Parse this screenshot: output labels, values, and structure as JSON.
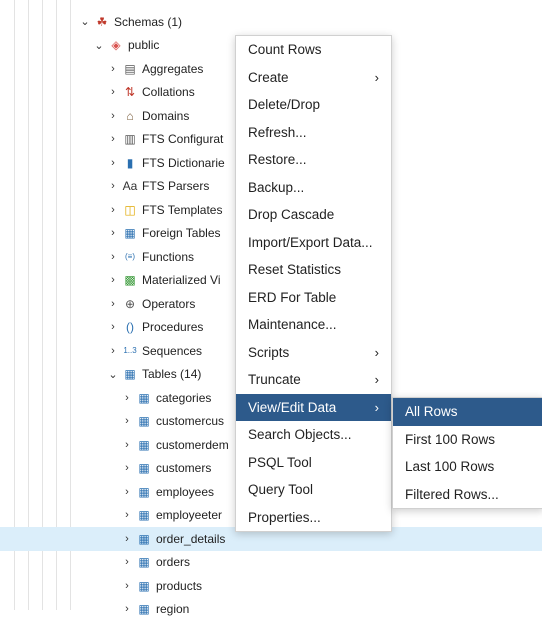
{
  "tree": {
    "items": [
      {
        "label": "Schemas (1)",
        "icon": "schemas-icon",
        "glyph": "☘",
        "color": "#c0392b",
        "expanded": true
      },
      {
        "label": "public",
        "icon": "schema-icon",
        "glyph": "◈",
        "color": "#d9534f",
        "expanded": true
      },
      {
        "label": "Aggregates",
        "icon": "aggregates-icon",
        "glyph": "▤",
        "color": "#555"
      },
      {
        "label": "Collations",
        "icon": "collations-icon",
        "glyph": "⇅",
        "color": "#c0392b"
      },
      {
        "label": "Domains",
        "icon": "domains-icon",
        "glyph": "⌂",
        "color": "#7a5c3a"
      },
      {
        "label": "FTS Configurat",
        "icon": "fts-configuration-icon",
        "glyph": "▥",
        "color": "#555"
      },
      {
        "label": "FTS Dictionarie",
        "icon": "fts-dictionaries-icon",
        "glyph": "▮",
        "color": "#2a6fb0"
      },
      {
        "label": "FTS Parsers",
        "icon": "fts-parsers-icon",
        "glyph": "Aa",
        "color": "#333"
      },
      {
        "label": "FTS Templates",
        "icon": "fts-templates-icon",
        "glyph": "◫",
        "color": "#e0a800"
      },
      {
        "label": "Foreign Tables",
        "icon": "foreign-tables-icon",
        "glyph": "▦",
        "color": "#2a6fb0"
      },
      {
        "label": "Functions",
        "icon": "functions-icon",
        "glyph": "(≡)",
        "color": "#2a6fb0"
      },
      {
        "label": "Materialized Vi",
        "icon": "materialized-views-icon",
        "glyph": "▩",
        "color": "#3a9a3a"
      },
      {
        "label": "Operators",
        "icon": "operators-icon",
        "glyph": "⊕",
        "color": "#555"
      },
      {
        "label": "Procedures",
        "icon": "procedures-icon",
        "glyph": "()",
        "color": "#2a6fb0"
      },
      {
        "label": "Sequences",
        "icon": "sequences-icon",
        "glyph": "1..3",
        "color": "#2a6fb0"
      },
      {
        "label": "Tables (14)",
        "icon": "tables-icon",
        "glyph": "▦",
        "color": "#2a6fb0",
        "expanded": true
      },
      {
        "label": "categories",
        "icon": "table-icon",
        "glyph": "▦",
        "color": "#2a6fb0"
      },
      {
        "label": "customercus",
        "icon": "table-icon",
        "glyph": "▦",
        "color": "#2a6fb0"
      },
      {
        "label": "customerdem",
        "icon": "table-icon",
        "glyph": "▦",
        "color": "#2a6fb0"
      },
      {
        "label": "customers",
        "icon": "table-icon",
        "glyph": "▦",
        "color": "#2a6fb0"
      },
      {
        "label": "employees",
        "icon": "table-icon",
        "glyph": "▦",
        "color": "#2a6fb0"
      },
      {
        "label": "employeeter",
        "icon": "table-icon",
        "glyph": "▦",
        "color": "#2a6fb0"
      },
      {
        "label": "order_details",
        "icon": "table-icon",
        "glyph": "▦",
        "color": "#2a6fb0",
        "selected": true
      },
      {
        "label": "orders",
        "icon": "table-icon",
        "glyph": "▦",
        "color": "#2a6fb0"
      },
      {
        "label": "products",
        "icon": "table-icon",
        "glyph": "▦",
        "color": "#2a6fb0"
      },
      {
        "label": "region",
        "icon": "table-icon",
        "glyph": "▦",
        "color": "#2a6fb0"
      }
    ]
  },
  "context_menu": {
    "items": [
      {
        "label": "Count Rows"
      },
      {
        "label": "Create",
        "submenu": true
      },
      {
        "label": "Delete/Drop"
      },
      {
        "label": "Refresh..."
      },
      {
        "label": "Restore..."
      },
      {
        "label": "Backup..."
      },
      {
        "label": "Drop Cascade"
      },
      {
        "label": "Import/Export Data..."
      },
      {
        "label": "Reset Statistics"
      },
      {
        "label": "ERD For Table"
      },
      {
        "label": "Maintenance..."
      },
      {
        "label": "Scripts",
        "submenu": true
      },
      {
        "label": "Truncate",
        "submenu": true
      },
      {
        "label": "View/Edit Data",
        "submenu": true,
        "active": true
      },
      {
        "label": "Search Objects..."
      },
      {
        "label": "PSQL Tool"
      },
      {
        "label": "Query Tool"
      },
      {
        "label": "Properties..."
      }
    ],
    "arrow_glyph": "›"
  },
  "submenu": {
    "items": [
      {
        "label": "All Rows",
        "active": true
      },
      {
        "label": "First 100 Rows"
      },
      {
        "label": "Last 100 Rows"
      },
      {
        "label": "Filtered Rows..."
      }
    ]
  },
  "colors": {
    "selection": "#dbeefa",
    "menu_active": "#2d5a8b"
  }
}
